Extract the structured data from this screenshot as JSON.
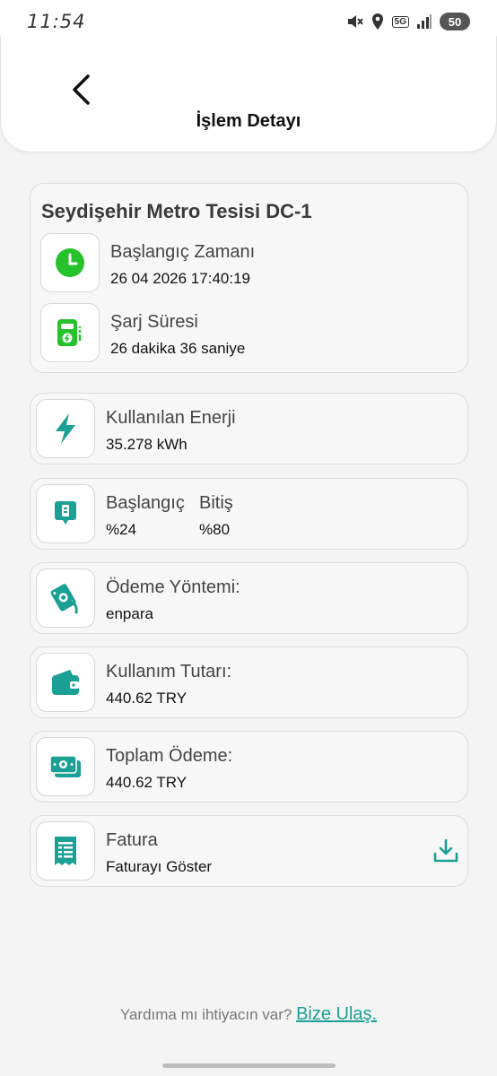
{
  "status_bar": {
    "time": "11:54",
    "network": "5G",
    "battery": "50"
  },
  "header": {
    "title": "İşlem Detayı"
  },
  "station": {
    "name": "Seydişehir Metro Tesisi DC-1",
    "start_time_label": "Başlangıç Zamanı",
    "start_time_value": "26 04 2026 17:40:19",
    "duration_label": "Şarj Süresi",
    "duration_value": "26 dakika 36 saniye"
  },
  "energy": {
    "label": "Kullanılan Enerji",
    "value": "35.278 kWh"
  },
  "battery_level": {
    "start_label": "Başlangıç",
    "start_value": "%24",
    "end_label": "Bitiş",
    "end_value": "%80"
  },
  "payment_method": {
    "label": "Ödeme Yöntemi:",
    "value": "enpara"
  },
  "usage_amount": {
    "label": "Kullanım Tutarı:",
    "value": "440.62 TRY"
  },
  "total_payment": {
    "label": "Toplam Ödeme:",
    "value": "440.62 TRY"
  },
  "invoice": {
    "label": "Fatura",
    "value": "Faturayı Göster"
  },
  "footer": {
    "question": "Yardıma mı ihtiyacın var? ",
    "link": "Bize Ulaş."
  },
  "colors": {
    "accent_green": "#25c22b",
    "teal": "#1aa094"
  }
}
